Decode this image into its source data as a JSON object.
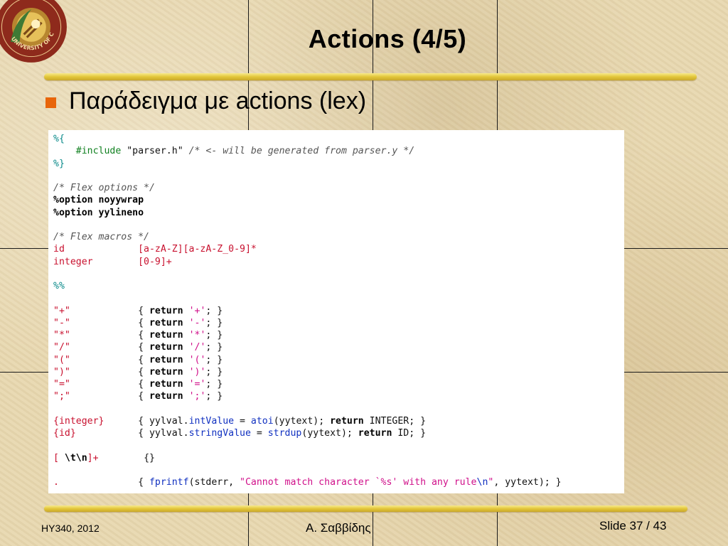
{
  "slide": {
    "title": "Actions (4/5)",
    "bullet": "Παράδειγμα με actions (lex)",
    "footer_left": "HY340, 2012",
    "footer_center": "Α. Σαββίδης",
    "footer_right": "Slide 37 / 43",
    "logo_text": "UNIVERSITY OF CRETE"
  },
  "colors": {
    "bullet": "#e8650a",
    "background": "#e8d8b0",
    "rule": "#e3c63a",
    "string": "#d0108a",
    "pattern": "#c8102e",
    "type": "#0a8a8a",
    "function": "#1030c0",
    "preprocessor": "#108020"
  },
  "code_lines": [
    [
      {
        "t": "%{",
        "c": "t"
      }
    ],
    [
      {
        "t": "    ",
        "c": "x"
      },
      {
        "t": "#include ",
        "c": "g"
      },
      {
        "t": "\"parser.h\" ",
        "c": "x"
      },
      {
        "t": "/* <- will be generated from parser.y */",
        "c": "c"
      }
    ],
    [
      {
        "t": "%}",
        "c": "t"
      }
    ],
    [
      {
        "t": "",
        "c": "x"
      }
    ],
    [
      {
        "t": "/* Flex options */",
        "c": "c"
      }
    ],
    [
      {
        "t": "%option noyywrap",
        "c": "k"
      }
    ],
    [
      {
        "t": "%option yylineno",
        "c": "k"
      }
    ],
    [
      {
        "t": "",
        "c": "x"
      }
    ],
    [
      {
        "t": "/* Flex macros */",
        "c": "c"
      }
    ],
    [
      {
        "t": "id             ",
        "c": "r"
      },
      {
        "t": "[a-zA-Z][a-zA-Z_0-9]*",
        "c": "r"
      }
    ],
    [
      {
        "t": "integer        ",
        "c": "r"
      },
      {
        "t": "[0-9]+",
        "c": "r"
      }
    ],
    [
      {
        "t": "",
        "c": "x"
      }
    ],
    [
      {
        "t": "%%",
        "c": "t"
      }
    ],
    [
      {
        "t": "",
        "c": "x"
      }
    ],
    [
      {
        "t": "\"+\"            ",
        "c": "r"
      },
      {
        "t": "{ ",
        "c": "x"
      },
      {
        "t": "return ",
        "c": "k"
      },
      {
        "t": "'+'",
        "c": "s"
      },
      {
        "t": "; }",
        "c": "x"
      }
    ],
    [
      {
        "t": "\"-\"            ",
        "c": "r"
      },
      {
        "t": "{ ",
        "c": "x"
      },
      {
        "t": "return ",
        "c": "k"
      },
      {
        "t": "'-'",
        "c": "s"
      },
      {
        "t": "; }",
        "c": "x"
      }
    ],
    [
      {
        "t": "\"*\"            ",
        "c": "r"
      },
      {
        "t": "{ ",
        "c": "x"
      },
      {
        "t": "return ",
        "c": "k"
      },
      {
        "t": "'*'",
        "c": "s"
      },
      {
        "t": "; }",
        "c": "x"
      }
    ],
    [
      {
        "t": "\"/\"            ",
        "c": "r"
      },
      {
        "t": "{ ",
        "c": "x"
      },
      {
        "t": "return ",
        "c": "k"
      },
      {
        "t": "'/'",
        "c": "s"
      },
      {
        "t": "; }",
        "c": "x"
      }
    ],
    [
      {
        "t": "\"(\"            ",
        "c": "r"
      },
      {
        "t": "{ ",
        "c": "x"
      },
      {
        "t": "return ",
        "c": "k"
      },
      {
        "t": "'('",
        "c": "s"
      },
      {
        "t": "; }",
        "c": "x"
      }
    ],
    [
      {
        "t": "\")\"            ",
        "c": "r"
      },
      {
        "t": "{ ",
        "c": "x"
      },
      {
        "t": "return ",
        "c": "k"
      },
      {
        "t": "')'",
        "c": "s"
      },
      {
        "t": "; }",
        "c": "x"
      }
    ],
    [
      {
        "t": "\"=\"            ",
        "c": "r"
      },
      {
        "t": "{ ",
        "c": "x"
      },
      {
        "t": "return ",
        "c": "k"
      },
      {
        "t": "'='",
        "c": "s"
      },
      {
        "t": "; }",
        "c": "x"
      }
    ],
    [
      {
        "t": "\";\"            ",
        "c": "r"
      },
      {
        "t": "{ ",
        "c": "x"
      },
      {
        "t": "return ",
        "c": "k"
      },
      {
        "t": "';'",
        "c": "s"
      },
      {
        "t": "; }",
        "c": "x"
      }
    ],
    [
      {
        "t": "",
        "c": "x"
      }
    ],
    [
      {
        "t": "{integer}      ",
        "c": "r"
      },
      {
        "t": "{ yylval.",
        "c": "x"
      },
      {
        "t": "intValue",
        "c": "b"
      },
      {
        "t": " = ",
        "c": "x"
      },
      {
        "t": "atoi",
        "c": "b"
      },
      {
        "t": "(yytext); ",
        "c": "x"
      },
      {
        "t": "return ",
        "c": "k"
      },
      {
        "t": "INTEGER; }",
        "c": "x"
      }
    ],
    [
      {
        "t": "{id}           ",
        "c": "r"
      },
      {
        "t": "{ yylval.",
        "c": "x"
      },
      {
        "t": "stringValue",
        "c": "b"
      },
      {
        "t": " = ",
        "c": "x"
      },
      {
        "t": "strdup",
        "c": "b"
      },
      {
        "t": "(yytext); ",
        "c": "x"
      },
      {
        "t": "return ",
        "c": "k"
      },
      {
        "t": "ID; }",
        "c": "x"
      }
    ],
    [
      {
        "t": "",
        "c": "x"
      }
    ],
    [
      {
        "t": "[ ",
        "c": "r"
      },
      {
        "t": "\\t\\n",
        "c": "k"
      },
      {
        "t": "]+        ",
        "c": "r"
      },
      {
        "t": "{}",
        "c": "x"
      }
    ],
    [
      {
        "t": "",
        "c": "x"
      }
    ],
    [
      {
        "t": ".              ",
        "c": "r"
      },
      {
        "t": "{ ",
        "c": "x"
      },
      {
        "t": "fprintf",
        "c": "b"
      },
      {
        "t": "(stderr, ",
        "c": "x"
      },
      {
        "t": "\"Cannot match character `%s' with any rule",
        "c": "s"
      },
      {
        "t": "\\n",
        "c": "b"
      },
      {
        "t": "\"",
        "c": "s"
      },
      {
        "t": ", yytext); }",
        "c": "x"
      }
    ]
  ]
}
